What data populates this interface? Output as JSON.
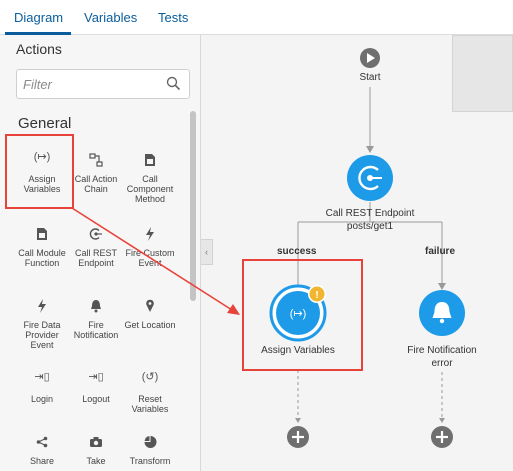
{
  "tabs": [
    {
      "label": "Diagram"
    },
    {
      "label": "Variables"
    },
    {
      "label": "Tests"
    }
  ],
  "actions_panel": {
    "title": "Actions",
    "filter_placeholder": "Filter",
    "group": "General",
    "items": [
      {
        "label": "Assign Variables",
        "icon": "assign-icon"
      },
      {
        "label": "Call Action Chain",
        "icon": "action-chain-icon"
      },
      {
        "label": "Call Component Method",
        "icon": "component-icon"
      },
      {
        "label": "Call Module Function",
        "icon": "module-icon"
      },
      {
        "label": "Call REST Endpoint",
        "icon": "rest-icon"
      },
      {
        "label": "Fire Custom Event",
        "icon": "lightning-icon"
      },
      {
        "label": "Fire Data Provider Event",
        "icon": "lightning-icon"
      },
      {
        "label": "Fire Notification",
        "icon": "bell-icon"
      },
      {
        "label": "Get Location",
        "icon": "location-icon"
      },
      {
        "label": "Login",
        "icon": "login-icon"
      },
      {
        "label": "Logout",
        "icon": "logout-icon"
      },
      {
        "label": "Reset Variables",
        "icon": "reset-icon"
      },
      {
        "label": "Share",
        "icon": "share-icon"
      },
      {
        "label": "Take",
        "icon": "camera-icon"
      },
      {
        "label": "Transform",
        "icon": "pie-icon"
      }
    ]
  },
  "diagram": {
    "start_label": "Start",
    "rest_node_label": "Call REST Endpoint",
    "rest_node_sub": "posts/get1",
    "success_label": "success",
    "failure_label": "failure",
    "assign_node_label": "Assign Variables",
    "notify_node_label": "Fire Notification",
    "notify_node_sub": "error"
  },
  "colors": {
    "accent": "#0a5d9c",
    "node_blue": "#1e9be8",
    "highlight_red": "#e8433b",
    "warning": "#f2b530"
  }
}
